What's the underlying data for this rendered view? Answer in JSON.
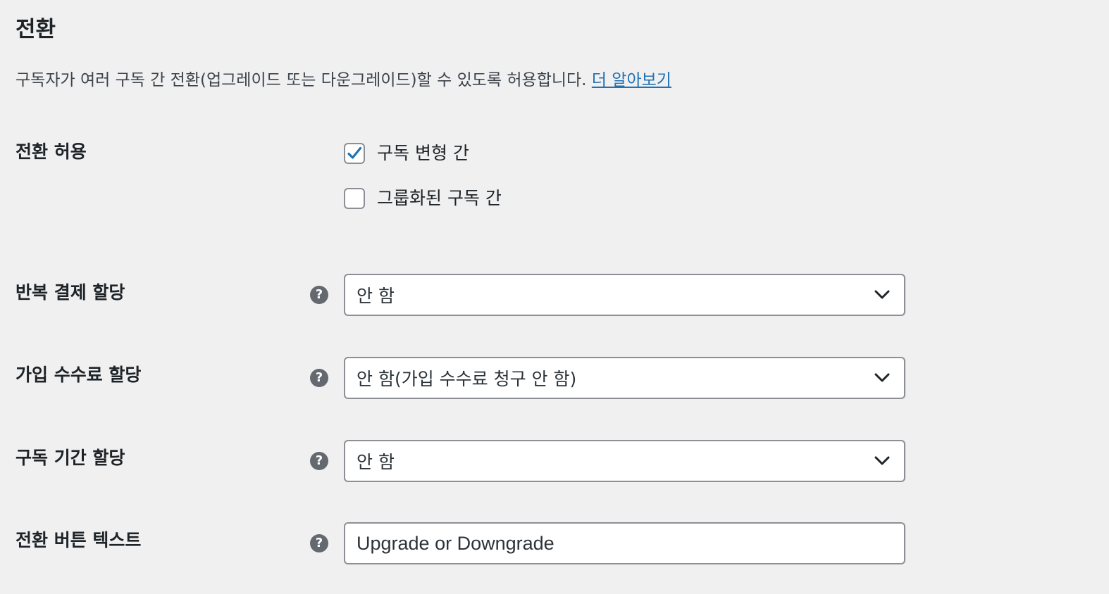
{
  "section": {
    "title": "전환",
    "description": "구독자가 여러 구독 간 전환(업그레이드 또는 다운그레이드)할 수 있도록 허용합니다.",
    "learn_more_link": "더 알아보기"
  },
  "allow_switching": {
    "label": "전환 허용",
    "options": [
      {
        "label": "구독 변형 간",
        "checked": true
      },
      {
        "label": "그룹화된 구독 간",
        "checked": false
      }
    ]
  },
  "fields": {
    "recurring_payment": {
      "label": "반복 결제 할당",
      "value": "안 함"
    },
    "signup_fee": {
      "label": "가입 수수료 할당",
      "value": "안 함(가입 수수료 청구 안 함)"
    },
    "subscription_length": {
      "label": "구독 기간 할당",
      "value": "안 함"
    },
    "button_text": {
      "label": "전환 버튼 텍스트",
      "value": "Upgrade or Downgrade"
    }
  },
  "icons": {
    "help": "help-question-icon",
    "checkmark": "checkmark-icon",
    "chevron": "chevron-down-icon"
  },
  "colors": {
    "background": "#f0f0f1",
    "link": "#2271b1",
    "checkmark": "#2271b1",
    "help_icon": "#646970",
    "field_border": "#8c8f94"
  }
}
